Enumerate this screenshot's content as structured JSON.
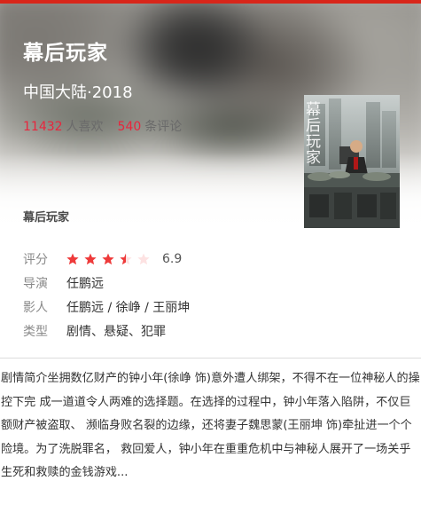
{
  "header": {
    "title": "幕后玩家",
    "meta": "中国大陆·2018",
    "likes_count": "11432",
    "likes_label": "人喜欢",
    "comments_count": "540",
    "comments_label": "条评论",
    "small_title": "幕后玩家"
  },
  "poster": {
    "text": "幕后玩家"
  },
  "info": {
    "rating_label": "评分",
    "rating_value": "6.9",
    "rating_stars": 3.5,
    "rating_stars_max": 5,
    "director_label": "导演",
    "director": "任鹏远",
    "cast_label": "影人",
    "cast": "任鹏远 / 徐峥 / 王丽坤",
    "genre_label": "类型",
    "genre": "剧情、悬疑、犯罪"
  },
  "synopsis": {
    "text": "剧情简介坐拥数亿财产的钟小年(徐峥 饰)意外遭人绑架，不得不在一位神秘人的操控下完 成一道道令人两难的选择题。在选择的过程中，钟小年落入陷阱，不仅巨额财产被盗取、 濒临身败名裂的边缘，还将妻子魏思蒙(王丽坤 饰)牵扯进一个个险境。为了洗脱罪名， 救回爱人，钟小年在重重危机中与神秘人展开了一场关乎生死和救赎的金钱游戏..."
  },
  "colors": {
    "accent": "#d8261a",
    "highlight": "#e8263d",
    "star_full": "#ee3a3a",
    "star_empty": "#fde2e2"
  }
}
